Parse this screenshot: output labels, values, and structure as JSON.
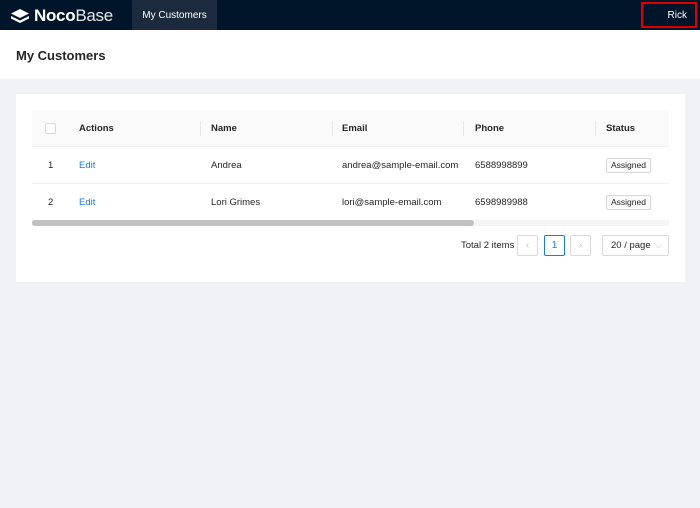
{
  "app": {
    "logo_bold": "Noco",
    "logo_light": "Base"
  },
  "nav": {
    "active_tab": "My Customers"
  },
  "user": {
    "name": "Rick"
  },
  "page": {
    "title": "My Customers"
  },
  "table": {
    "columns": [
      "Actions",
      "Name",
      "Email",
      "Phone",
      "Status"
    ],
    "rows": [
      {
        "index": "1",
        "action": "Edit",
        "name": "Andrea",
        "email": "andrea@sample-email.com",
        "phone": "6588998899",
        "status": "Assigned"
      },
      {
        "index": "2",
        "action": "Edit",
        "name": "Lori Grimes",
        "email": "lori@sample-email.com",
        "phone": "6598989988",
        "status": "Assigned"
      }
    ]
  },
  "pagination": {
    "total_label": "Total 2 items",
    "current_page": "1",
    "page_size": "20 / page"
  },
  "colors": {
    "header_bg": "#001529",
    "link": "#1677ff",
    "highlight": "#e00000"
  }
}
